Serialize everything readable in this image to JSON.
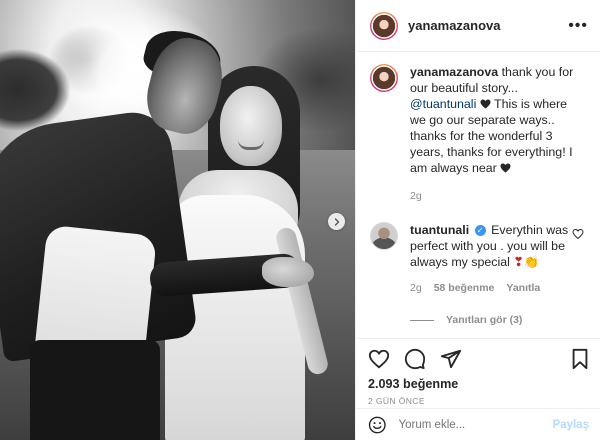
{
  "post": {
    "username": "yanamazanova",
    "more_icon": "ellipsis-icon",
    "caption": {
      "username": "yanamazanova",
      "text_before_mention": "thank you for our beautiful story... ",
      "mention": "@tuantunali",
      "text_after_mention": " This is where we go our separate ways.. thanks for the wonderful 3 years, thanks for everything! I am always near ",
      "age": "2g"
    },
    "top_comment": {
      "username": "tuantunali",
      "text": "Everythin was perfect with you . you will be always my special",
      "emojis": "❣👏",
      "age": "2g",
      "likes": "58 beğenme",
      "reply_label": "Yanıtla",
      "view_replies": "Yanıtları gör (3)"
    },
    "likes": "2.093 beğenme",
    "time": "2 GÜN ÖNCE",
    "comment_placeholder": "Yorum ekle...",
    "post_button": "Paylaş",
    "blurred_comment_emojis": "👏👏"
  }
}
